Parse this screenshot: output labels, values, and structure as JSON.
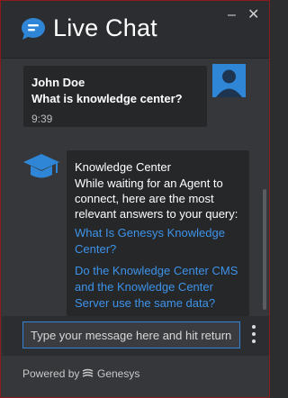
{
  "header": {
    "title": "Live Chat",
    "minimize_label": "–",
    "close_label": "✕"
  },
  "transcript": {
    "user_message": {
      "name": "John Doe",
      "text": "What is knowledge center?",
      "time": "9:39"
    },
    "bot_message": {
      "name": "Knowledge Center",
      "text": "While waiting for an Agent to connect, here are the most relevant answers to your query:",
      "links": [
        "What Is Genesys Knowledge Center?",
        "Do the Knowledge Center CMS and the Knowledge Center Server use the same data?"
      ]
    }
  },
  "input": {
    "placeholder": "Type your message here and hit return"
  },
  "footer": {
    "powered_by": "Powered by",
    "brand": "Genesys"
  },
  "colors": {
    "accent": "#2f86d6",
    "link": "#3d93ea",
    "border": "#8a1c1c"
  }
}
